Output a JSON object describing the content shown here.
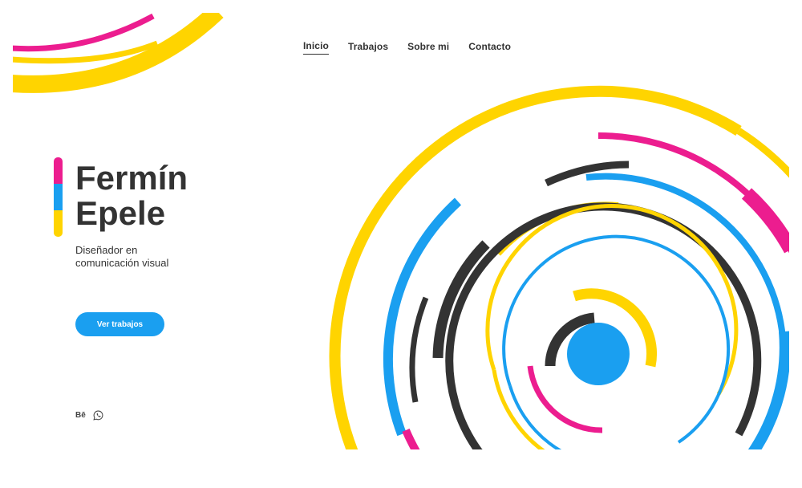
{
  "nav": {
    "items": [
      {
        "label": "Inicio",
        "active": true
      },
      {
        "label": "Trabajos",
        "active": false
      },
      {
        "label": "Sobre mi",
        "active": false
      },
      {
        "label": "Contacto",
        "active": false
      }
    ]
  },
  "hero": {
    "title_line1": "Fermín",
    "title_line2": "Epele",
    "subtitle_line1": "Diseñador en",
    "subtitle_line2": "comunicación visual",
    "cta_label": "Ver trabajos"
  },
  "social": {
    "behance_label": "Bē",
    "whatsapp_icon": "whatsapp-icon"
  },
  "colors": {
    "magenta": "#ec1d8f",
    "blue": "#1a9ff0",
    "yellow": "#ffd400",
    "dark": "#333333",
    "text": "#333333"
  }
}
